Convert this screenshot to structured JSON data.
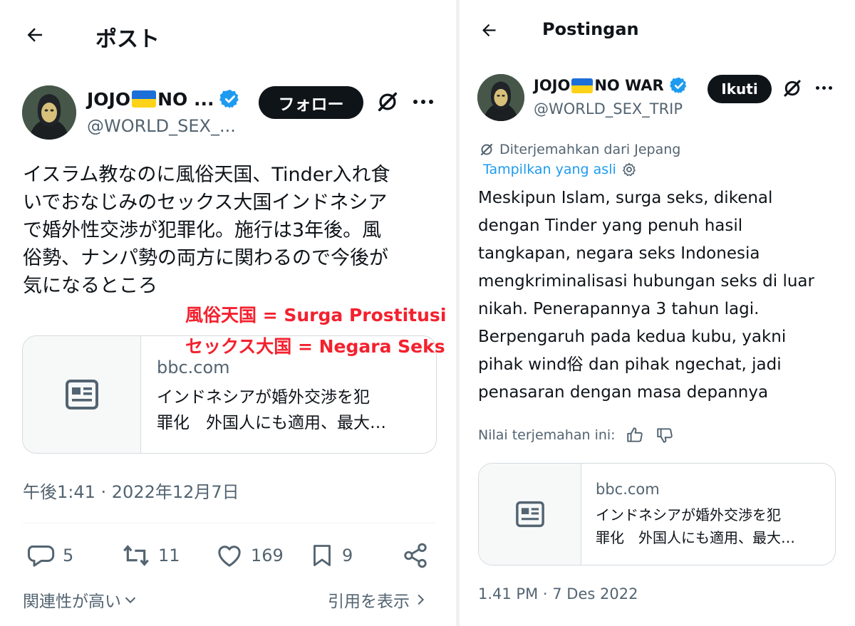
{
  "left": {
    "header_title": "ポスト",
    "author": {
      "name_prefix": "JOJO",
      "name_suffix": "NO ...",
      "handle": "@WORLD_SEX_..."
    },
    "avatar_label": "JOJO",
    "follow_label": "フォロー",
    "tweet_lines": [
      "イスラム教なのに風俗天国、Tinder入れ食",
      "いでおなじみのセックス大国インドネシア",
      "で婚外性交渉が犯罪化。施行は3年後。風",
      "俗勢、ナンパ勢の両方に関わるので今後が",
      "気になるところ"
    ],
    "annotations": [
      "風俗天国 = Surga Prostitusi",
      "セックス大国 = Negara Seks"
    ],
    "card": {
      "domain": "bbc.com",
      "title_line1": "インドネシアが婚外交渉を犯",
      "title_line2": "罪化　外国人にも適用、最大…"
    },
    "timestamp": "午後1:41 · 2022年12月7日",
    "counts": {
      "replies": "5",
      "reposts": "11",
      "likes": "169",
      "bookmarks": "9"
    },
    "relevance_label": "関連性が高い",
    "quotes_label": "引用を表示"
  },
  "right": {
    "header_title": "Postingan",
    "author": {
      "name_prefix": "JOJO",
      "name_suffix": "NO WAR",
      "handle": "@WORLD_SEX_TRIP"
    },
    "avatar_label": "JOJO",
    "follow_label": "Ikuti",
    "translated_from": "Diterjemahkan dari Jepang",
    "show_original": "Tampilkan yang asli",
    "tweet_lines": [
      "Meskipun Islam, surga seks, dikenal",
      "dengan Tinder yang penuh hasil",
      "tangkapan, negara seks Indonesia",
      "mengkriminalisasi hubungan seks di luar",
      "nikah. Penerapannya 3 tahun lagi.",
      "Berpengaruh pada kedua kubu, yakni",
      "pihak wind俗 dan pihak ngechat, jadi",
      "penasaran dengan masa depannya"
    ],
    "rate_label": "Nilai terjemahan ini:",
    "card": {
      "domain": "bbc.com",
      "title_line1": "インドネシアが婚外交渉を犯",
      "title_line2": "罪化　外国人にも適用、最大…"
    },
    "timestamp": "1.41 PM · 7 Des 2022"
  },
  "colors": {
    "text": "#0f1419",
    "secondary": "#536471",
    "accent": "#1d9bf0",
    "verified": "#1d9bf0",
    "annotation": "#f4212e",
    "border": "#d5dbe0"
  },
  "icons": [
    "back-arrow-icon",
    "verified-badge-icon",
    "grok-icon",
    "more-icon",
    "article-icon",
    "reply-icon",
    "repost-icon",
    "like-icon",
    "bookmark-icon",
    "share-icon",
    "chevron-down-icon",
    "chevron-right-icon",
    "translate-icon",
    "gear-icon",
    "thumbs-up-icon",
    "thumbs-down-icon"
  ]
}
